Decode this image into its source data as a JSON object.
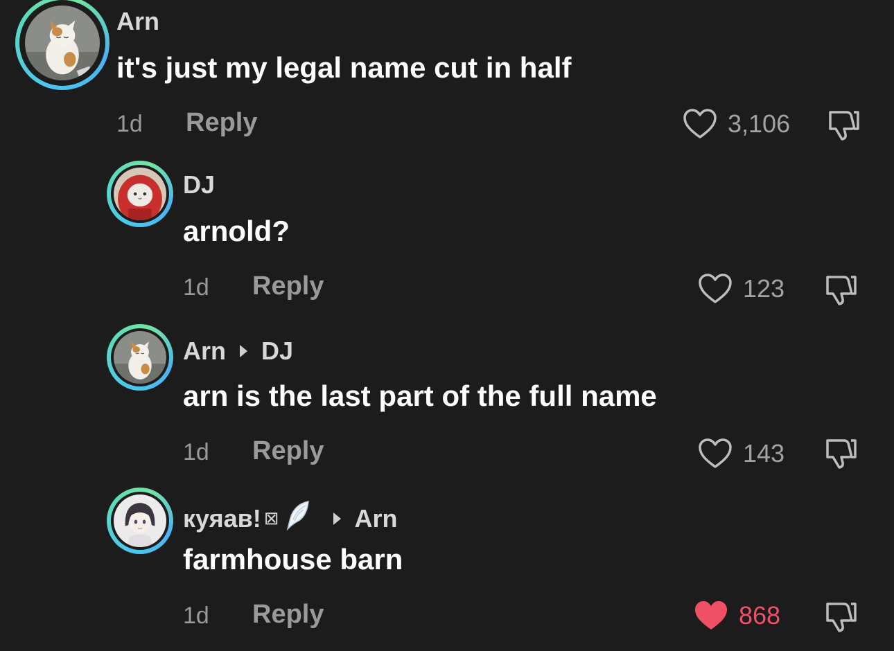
{
  "colors": {
    "background": "#1c1c1c",
    "meta_text": "#9a9a9a",
    "liked": "#ef5066",
    "ring_start": "#4cc7ee",
    "ring_end": "#72e6a1"
  },
  "comments": [
    {
      "username": "Arn",
      "reply_to": "",
      "text": "it's just my legal name cut in half",
      "time": "1d",
      "reply_label": "Reply",
      "likes": "3,106",
      "liked": false,
      "avatar_icon": "cat-avatar-icon"
    },
    {
      "username": "DJ",
      "reply_to": "",
      "text": "arnold?",
      "time": "1d",
      "reply_label": "Reply",
      "likes": "123",
      "liked": false,
      "avatar_icon": "hooded-cat-avatar-icon"
    },
    {
      "username": "Arn",
      "reply_to": "DJ",
      "text": "arn is the last part of the full name",
      "time": "1d",
      "reply_label": "Reply",
      "likes": "143",
      "liked": false,
      "avatar_icon": "cat-avatar-icon"
    },
    {
      "username": "куяав!",
      "username_deco": "⊠",
      "reply_to": "Arn",
      "text": "farmhouse barn",
      "time": "1d",
      "reply_label": "Reply",
      "likes": "868",
      "liked": true,
      "avatar_icon": "anime-girl-avatar-icon"
    }
  ]
}
